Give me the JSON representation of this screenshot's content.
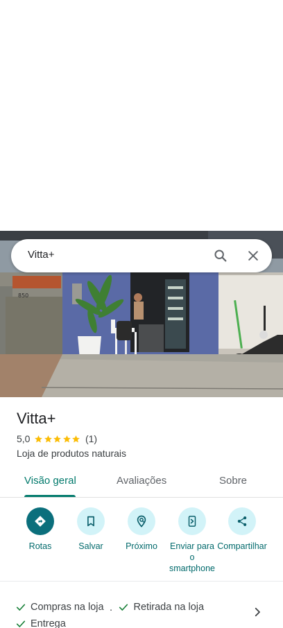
{
  "search": {
    "query": "Vitta+"
  },
  "place": {
    "name": "Vitta+",
    "rating": "5,0",
    "stars": 5,
    "review_count": "(1)",
    "category": "Loja de produtos naturais",
    "photo_house_number": "850"
  },
  "tabs": [
    {
      "label": "Visão geral",
      "active": true
    },
    {
      "label": "Avaliações",
      "active": false
    },
    {
      "label": "Sobre",
      "active": false
    }
  ],
  "actions": [
    {
      "label": "Rotas",
      "icon": "directions-icon"
    },
    {
      "label": "Salvar",
      "icon": "bookmark-icon"
    },
    {
      "label": "Próximo",
      "icon": "nearby-icon"
    },
    {
      "label": "Enviar para o smartphone",
      "icon": "send-to-phone-icon"
    },
    {
      "label": "Compartilhar",
      "icon": "share-icon"
    }
  ],
  "services": {
    "item1": "Compras na loja",
    "separator": "·",
    "item2": "Retirada na loja",
    "item3": "Entrega"
  },
  "colors": {
    "accent": "#00796b",
    "action_bg": "#d2f3f8",
    "primary_action_bg": "#0b6f7c",
    "star": "#fbbc04",
    "check": "#188038"
  }
}
